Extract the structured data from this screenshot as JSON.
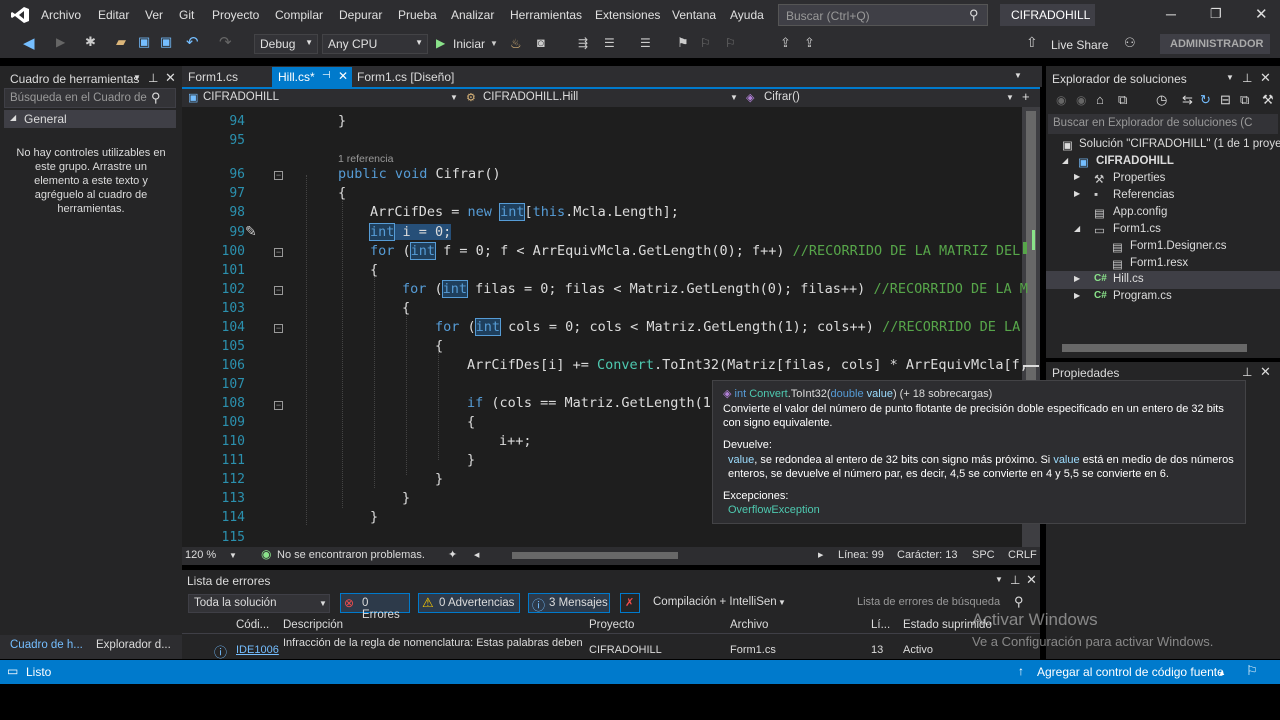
{
  "menu": {
    "items": [
      "Archivo",
      "Editar",
      "Ver",
      "Git",
      "Proyecto",
      "Compilar",
      "Depurar",
      "Prueba",
      "Analizar",
      "Herramientas",
      "Extensiones",
      "Ventana",
      "Ayuda"
    ],
    "search_placeholder": "Buscar (Ctrl+Q)",
    "solution_name": "CIFRADOHILL"
  },
  "toolbar": {
    "config": "Debug",
    "platform": "Any CPU",
    "start": "Iniciar",
    "live_share": "Live Share",
    "admin": "ADMINISTRADOR"
  },
  "toolbox": {
    "title": "Cuadro de herramientas",
    "search": "Búsqueda en el Cuadro de",
    "group": "General",
    "empty": "No hay controles utilizables en este grupo. Arrastre un elemento a este texto y agréguelo al cuadro de herramientas.",
    "tab1": "Cuadro de h...",
    "tab2": "Explorador d..."
  },
  "tabs": {
    "t1": "Form1.cs",
    "t2": "Hill.cs*",
    "t3": "Form1.cs [Diseño]"
  },
  "nav": {
    "project": "CIFRADOHILL",
    "class": "CIFRADOHILL.Hill",
    "method": "Cifrar()"
  },
  "editor": {
    "lines": [
      "94",
      "95",
      "96",
      "97",
      "98",
      "99",
      "100",
      "101",
      "102",
      "103",
      "104",
      "105",
      "106",
      "107",
      "108",
      "109",
      "110",
      "111",
      "112",
      "113",
      "114",
      "115"
    ],
    "ref": "1 referencia",
    "c94": "}",
    "c96a": "public void ",
    "c96b": "Cifrar()",
    "c97": "{",
    "c98a": "ArrCifDes = ",
    "c98b": "new ",
    "c98c": "int",
    "c98d": "[",
    "c98e": "this",
    ".": ".",
    "c98f": ".Mcla.Length];",
    "c99a": "int",
    " c99b": " i = 0;",
    "c100a": "for ",
    "c100b": "(",
    "c100c": "int",
    "c100d": " f = 0; f < ArrEquivMcla.GetLength(0); f++) ",
    "c100e": "//RECORRIDO DE LA MATRIZ DEL",
    "c101": "{",
    "c102a": "for ",
    "c102b": "(",
    "c102c": "int",
    "c102d": " filas = 0; filas < Matriz.GetLength(0); filas++) ",
    "c102e": "//RECORRIDO DE LA M",
    "c103": "{",
    "c104a": "for ",
    "c104b": "(",
    "c104c": "int",
    "c104d": " cols = 0; cols < Matriz.GetLength(1); cols++) ",
    "c104e": "//RECORRIDO DE LA",
    "c105": "{",
    "c106a": "ArrCifDes[i] += ",
    "c106b": "Convert",
    ".c": ".",
    "c106c": "ToInt32(Matriz[filas, cols] * ArrEquivMcla[f,",
    "c108a": "if ",
    "c108b": "(cols == Matriz.GetLength(1",
    "c109": "{",
    "c110": "i++;",
    "c111": "}",
    "c112": "}",
    "c113": "}",
    "c114": "}"
  },
  "tooltip": {
    "sig_a": "int ",
    "sig_b": "Convert",
    "sig_c": ".ToInt32(",
    "sig_d": "double ",
    "sig_e": "value",
    ") ": ") (+ 18 sobrecargas)",
    "sig_f": ") (+ 18 sobrecargas)",
    "desc": "Convierte el valor del número de punto flotante de precisión doble especificado en un entero de 32 bits con signo equivalente.",
    "ret_h": "Devuelve:",
    "ret_v": "value",
    "ret_t": ", se redondea al entero de 32 bits con signo más próximo. Si ",
    "ret_v2": "value",
    "ret_t2": " está en medio de dos números enteros, se devuelve el número par, es decir, 4,5 se convierte en 4 y 5,5 se convierte en 6.",
    "exc_h": "Excepciones:",
    "exc": "OverflowException"
  },
  "status_editor": {
    "zoom": "120 %",
    "problems": "No se encontraron problemas.",
    "line": "Línea: 99",
    "char": "Carácter: 13",
    "spc": "SPC",
    "crlf": "CRLF"
  },
  "solution": {
    "title": "Explorador de soluciones",
    "search": "Buscar en Explorador de soluciones (C",
    "root": "Solución \"CIFRADOHILL\" (1 de 1 proyec",
    "items": [
      "CIFRADOHILL",
      "Properties",
      "Referencias",
      "App.config",
      "Form1.cs",
      "Form1.Designer.cs",
      "Form1.resx",
      "Hill.cs",
      "Program.cs"
    ]
  },
  "properties": {
    "title": "Propiedades"
  },
  "errors": {
    "title": "Lista de errores",
    "scope": "Toda la solución",
    "err": "0 Errores",
    "warn": "0 Advertencias",
    "msg": "3 Mensajes",
    "build": "Compilación + IntelliSen",
    "search": "Lista de errores de búsqueda",
    "cols": [
      "Códi...",
      "Descripción",
      "Proyecto",
      "Archivo",
      "Lí...",
      "Estado suprimido"
    ],
    "row": {
      "code": "IDE1006",
      "desc": "Infracción de la regla de nomenclatura: Estas palabras deben",
      "proj": "CIFRADOHILL",
      "file": "Form1.cs",
      "line": "13",
      "state": "Activo"
    }
  },
  "watermark": {
    "l1": "Activar Windows",
    "l2": "Ve a Configuración para activar Windows."
  },
  "statusbar": {
    "ready": "Listo",
    "source": "Agregar al control de código fuente"
  },
  "colors": {
    "accent": "#007acc",
    "editor_bg": "#1e1e1e",
    "panel_bg": "#252526",
    "chrome": "#2d2d30"
  }
}
